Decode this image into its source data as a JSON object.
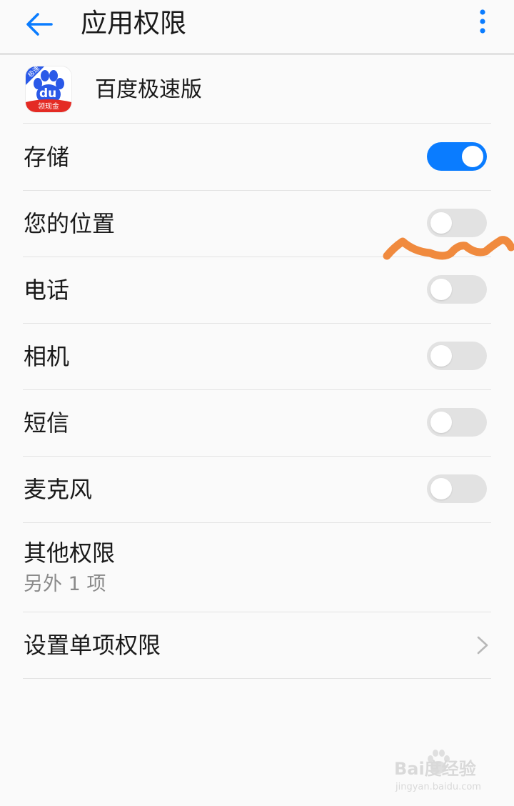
{
  "header": {
    "title": "应用权限",
    "back_icon": "arrow-left-icon",
    "more_icon": "more-vertical-icon"
  },
  "app": {
    "name": "百度极速版",
    "icon": "baidu-paw-icon",
    "badge_corner": "极速",
    "badge_bottom": "领现金"
  },
  "permissions": [
    {
      "label": "存储",
      "enabled": true
    },
    {
      "label": "您的位置",
      "enabled": false
    },
    {
      "label": "电话",
      "enabled": false
    },
    {
      "label": "相机",
      "enabled": false
    },
    {
      "label": "短信",
      "enabled": false
    },
    {
      "label": "麦克风",
      "enabled": false
    }
  ],
  "other": {
    "title": "其他权限",
    "subtitle": "另外 1 项"
  },
  "single": {
    "label": "设置单项权限",
    "icon": "chevron-right-icon"
  },
  "watermark": {
    "main": "Bai度经验",
    "sub": "jingyan.baidu.com"
  },
  "colors": {
    "accent": "#0a7cff",
    "switch_off": "#e2e2e2",
    "annotation": "#f08a3e",
    "baidu_red": "#e42b24",
    "baidu_blue": "#2a59e8"
  }
}
